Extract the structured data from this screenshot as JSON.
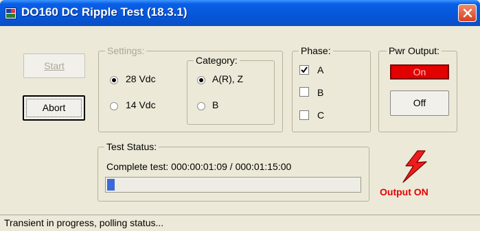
{
  "window": {
    "title": "DO160 DC Ripple Test (18.3.1)"
  },
  "buttons": {
    "start": "Start",
    "abort": "Abort"
  },
  "settings": {
    "label": "Settings:",
    "options": [
      {
        "label": "28 Vdc",
        "checked": true
      },
      {
        "label": "14 Vdc",
        "checked": false
      }
    ]
  },
  "category": {
    "label": "Category:",
    "options": [
      {
        "label": "A(R), Z",
        "checked": true
      },
      {
        "label": "B",
        "checked": false
      }
    ]
  },
  "phase": {
    "label": "Phase:",
    "options": [
      {
        "label": "A",
        "checked": true
      },
      {
        "label": "B",
        "checked": false
      },
      {
        "label": "C",
        "checked": false
      }
    ]
  },
  "power_output": {
    "label": "Pwr Output:",
    "on_label": "On",
    "off_label": "Off",
    "status_text": "Output ON",
    "indicator_color": "#e20000"
  },
  "test_status": {
    "label": "Test Status:",
    "text": "Complete test: 000:00:01:09 / 000:01:15:00",
    "progress": 0.03
  },
  "status_bar": {
    "text": "Transient in progress, polling status..."
  }
}
